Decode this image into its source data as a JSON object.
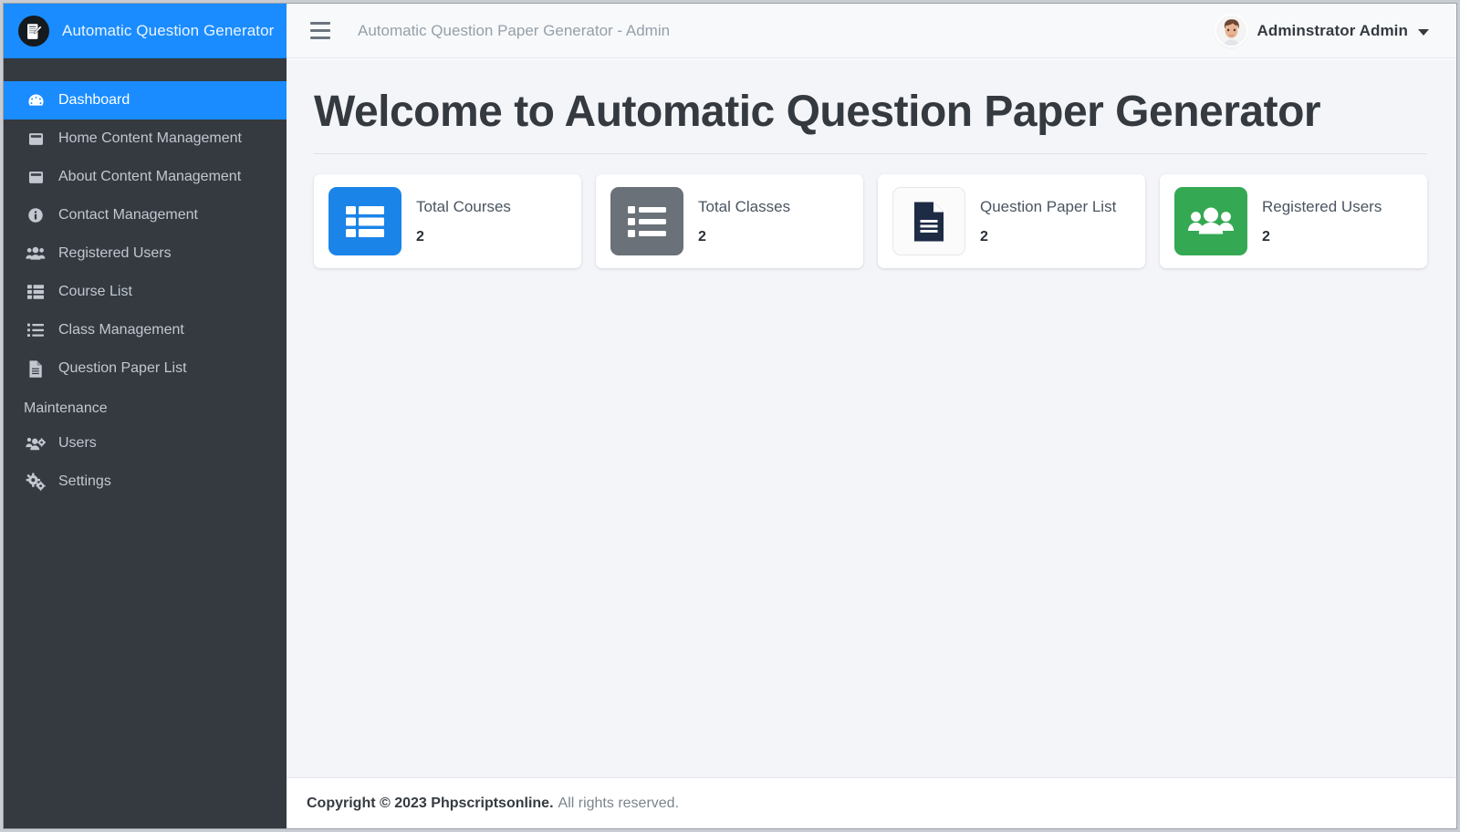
{
  "sidebar": {
    "brand": {
      "title": "Automatic Question Generator",
      "logo_icon": "document-pencil-icon"
    },
    "items": [
      {
        "label": "Dashboard",
        "icon": "tachometer-icon",
        "active": true
      },
      {
        "label": "Home Content Management",
        "icon": "window-maximize-icon",
        "active": false
      },
      {
        "label": "About Content Management",
        "icon": "window-maximize-icon",
        "active": false
      },
      {
        "label": "Contact Management",
        "icon": "info-circle-icon",
        "active": false
      },
      {
        "label": "Registered Users",
        "icon": "users-icon",
        "active": false
      },
      {
        "label": "Course List",
        "icon": "th-list-icon",
        "active": false
      },
      {
        "label": "Class Management",
        "icon": "list-ul-icon",
        "active": false
      },
      {
        "label": "Question Paper List",
        "icon": "file-lines-icon",
        "active": false
      }
    ],
    "section_header": "Maintenance",
    "maintenance_items": [
      {
        "label": "Users",
        "icon": "users-cog-icon"
      },
      {
        "label": "Settings",
        "icon": "cogs-icon"
      }
    ]
  },
  "topbar": {
    "menu_toggle_icon": "hamburger-icon",
    "title": "Automatic Question Paper Generator - Admin",
    "user_name": "Adminstrator Admin",
    "avatar_icon": "user-avatar",
    "caret_icon": "chevron-down-icon"
  },
  "main": {
    "page_title": "Welcome to Automatic Question Paper Generator",
    "cards": [
      {
        "label": "Total Courses",
        "value": "2",
        "icon": "th-list-icon",
        "color": "#1a84e8",
        "style": "blue"
      },
      {
        "label": "Total Classes",
        "value": "2",
        "icon": "list-ul-icon",
        "color": "#6a7178",
        "style": "gray"
      },
      {
        "label": "Question Paper List",
        "value": "2",
        "icon": "file-lines-icon",
        "color": "#1d2b45",
        "style": "white"
      },
      {
        "label": "Registered Users",
        "value": "2",
        "icon": "users-icon",
        "color": "#34a853",
        "style": "green"
      }
    ]
  },
  "footer": {
    "copyright_bold": "Copyright © 2023 Phpscriptsonline.",
    "copyright_rest": "All rights reserved."
  },
  "colors": {
    "accent_blue": "#1a8cff",
    "sidebar_bg": "#343a40",
    "content_bg": "#f4f5f9",
    "green": "#34a853",
    "gray": "#6a7178"
  }
}
